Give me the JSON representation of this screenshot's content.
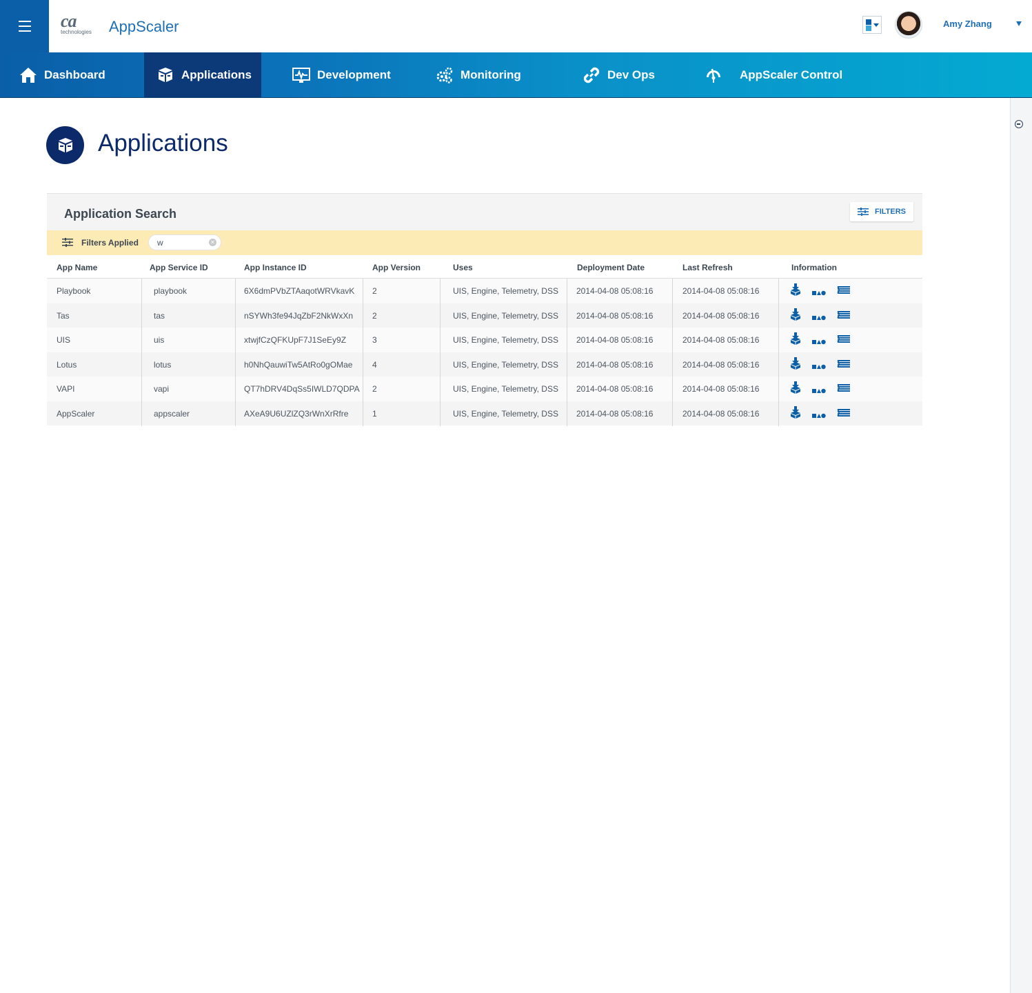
{
  "header": {
    "logo_text": "ca",
    "logo_subtext": "technologies",
    "app_title": "AppScaler",
    "user_name": "Amy Zhang"
  },
  "nav": {
    "items": [
      {
        "label": "Dashboard",
        "icon": "home-icon"
      },
      {
        "label": "Applications",
        "icon": "boxes-icon",
        "active": true
      },
      {
        "label": "Development",
        "icon": "monitor-icon"
      },
      {
        "label": "Monitoring",
        "icon": "gears-icon"
      },
      {
        "label": "Dev Ops",
        "icon": "link-icon"
      },
      {
        "label": "AppScaler Control",
        "icon": "gauge-icon"
      }
    ]
  },
  "page": {
    "title": "Applications",
    "icon": "box-icon"
  },
  "search": {
    "title": "Application Search",
    "filters_button": "FILTERS",
    "filters_applied_label": "Filters Applied",
    "filter_chip_value": "w"
  },
  "table": {
    "columns": [
      "App Name",
      "App Service ID",
      "App Instance ID",
      "App Version",
      "Uses",
      "Deployment Date",
      "Last Refresh",
      "Information"
    ],
    "rows": [
      {
        "name": "Playbook",
        "service_id": "playbook",
        "instance_id": "6X6dmPVbZTAaqotWRVkavK",
        "version": "2",
        "uses": "UIS, Engine, Telemetry, DSS",
        "deployed": "2014-04-08  05:08:16",
        "refresh": "2014-04-08  05:08:16"
      },
      {
        "name": "Tas",
        "service_id": "tas",
        "instance_id": "nSYWh3fe94JqZbF2NkWxXn",
        "version": "2",
        "uses": "UIS, Engine, Telemetry, DSS",
        "deployed": "2014-04-08  05:08:16",
        "refresh": "2014-04-08  05:08:16"
      },
      {
        "name": "UIS",
        "service_id": "uis",
        "instance_id": "xtwjfCzQFKUpF7J1SeEy9Z",
        "version": "3",
        "uses": "UIS, Engine, Telemetry, DSS",
        "deployed": "2014-04-08  05:08:16",
        "refresh": "2014-04-08  05:08:16"
      },
      {
        "name": "Lotus",
        "service_id": "lotus",
        "instance_id": "h0NhQauwiTw5AtRo0gOMae",
        "version": "4",
        "uses": "UIS, Engine, Telemetry, DSS",
        "deployed": "2014-04-08  05:08:16",
        "refresh": "2014-04-08  05:08:16"
      },
      {
        "name": "VAPI",
        "service_id": "vapi",
        "instance_id": "QT7hDRV4DqSs5IWLD7QDPA",
        "version": "2",
        "uses": "UIS, Engine, Telemetry, DSS",
        "deployed": "2014-04-08  05:08:16",
        "refresh": "2014-04-08  05:08:16"
      },
      {
        "name": "AppScaler",
        "service_id": "appscaler",
        "instance_id": "AXeA9U6UZlZQ3rWnXrRfre",
        "version": "1",
        "uses": "UIS, Engine, Telemetry, DSS",
        "deployed": "2014-04-08  05:08:16",
        "refresh": "2014-04-08  05:08:16"
      }
    ],
    "info_icons": [
      "deploy-icon",
      "shapes-icon",
      "layers-icon"
    ]
  },
  "colors": {
    "primary": "#0a5fa8",
    "nav_active": "#0c3a78",
    "accent_text": "#1f6fb5",
    "page_title": "#0c2a6a",
    "filter_bar": "#fdebb6"
  }
}
